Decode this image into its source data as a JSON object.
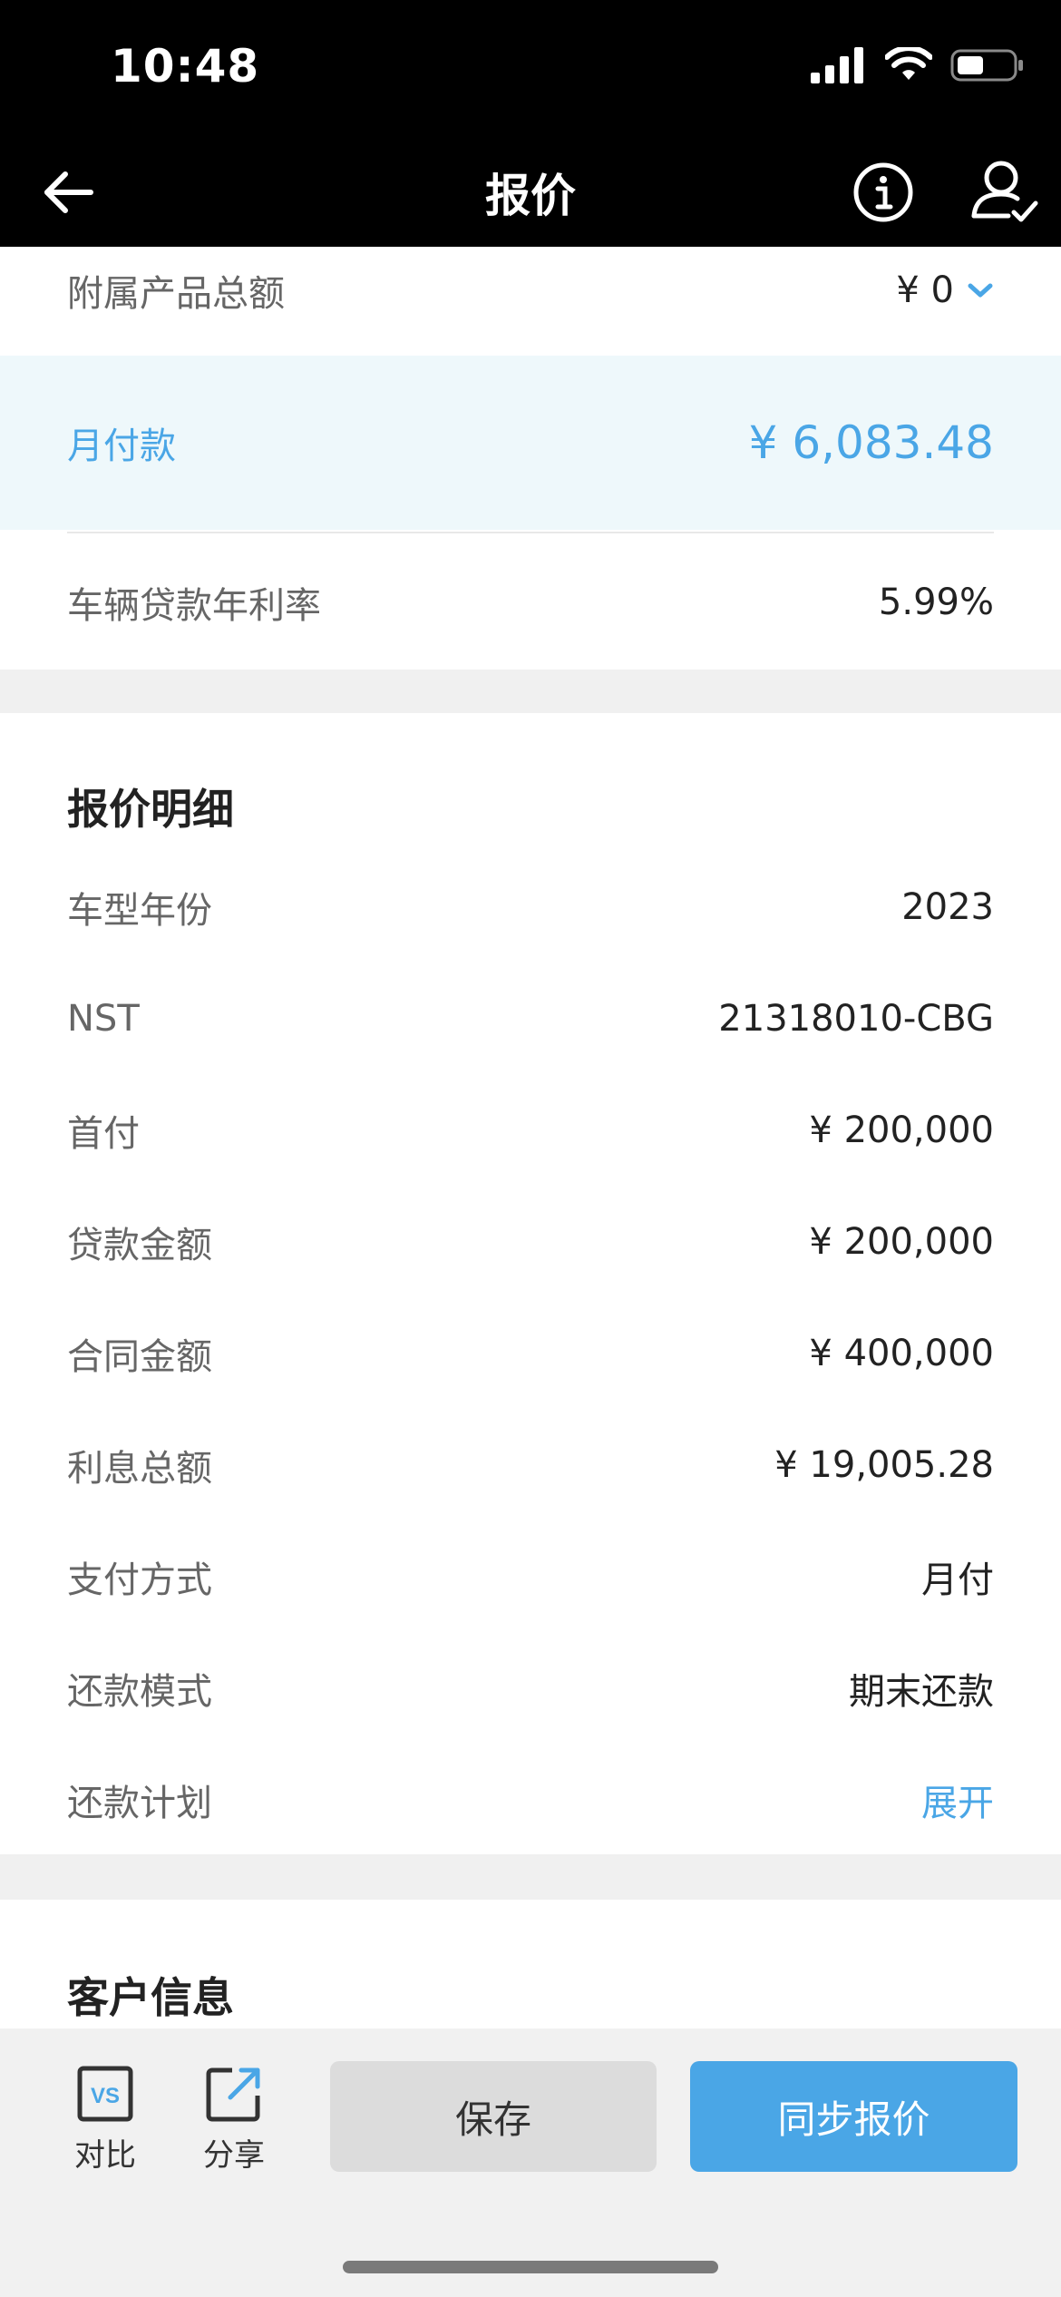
{
  "status_bar": {
    "time": "10:48"
  },
  "nav": {
    "title": "报价"
  },
  "summary": {
    "accessory_total": {
      "label": "附属产品总额",
      "value": "¥ 0"
    },
    "monthly_payment": {
      "label": "月付款",
      "value": "¥ 6,083.48"
    },
    "annual_rate": {
      "label": "车辆贷款年利率",
      "value": "5.99%"
    }
  },
  "details": {
    "title": "报价明细",
    "rows": [
      {
        "label": "车型年份",
        "value": "2023"
      },
      {
        "label": "NST",
        "value": "21318010-CBG"
      },
      {
        "label": "首付",
        "value": "¥ 200,000"
      },
      {
        "label": "贷款金额",
        "value": "¥ 200,000"
      },
      {
        "label": "合同金额",
        "value": "¥ 400,000"
      },
      {
        "label": "利息总额",
        "value": "¥ 19,005.28"
      },
      {
        "label": "支付方式",
        "value": "月付"
      },
      {
        "label": "还款模式",
        "value": "期末还款"
      },
      {
        "label": "还款计划",
        "value": "展开"
      }
    ]
  },
  "customer": {
    "title": "客户信息"
  },
  "toolbar": {
    "compare_label": "对比",
    "compare_icon_text": "VS",
    "share_label": "分享",
    "save_label": "保存",
    "sync_label": "同步报价"
  },
  "colors": {
    "accent": "#4aa6e6",
    "highlight_bg": "#eef8fb",
    "header_bg": "#000000"
  }
}
